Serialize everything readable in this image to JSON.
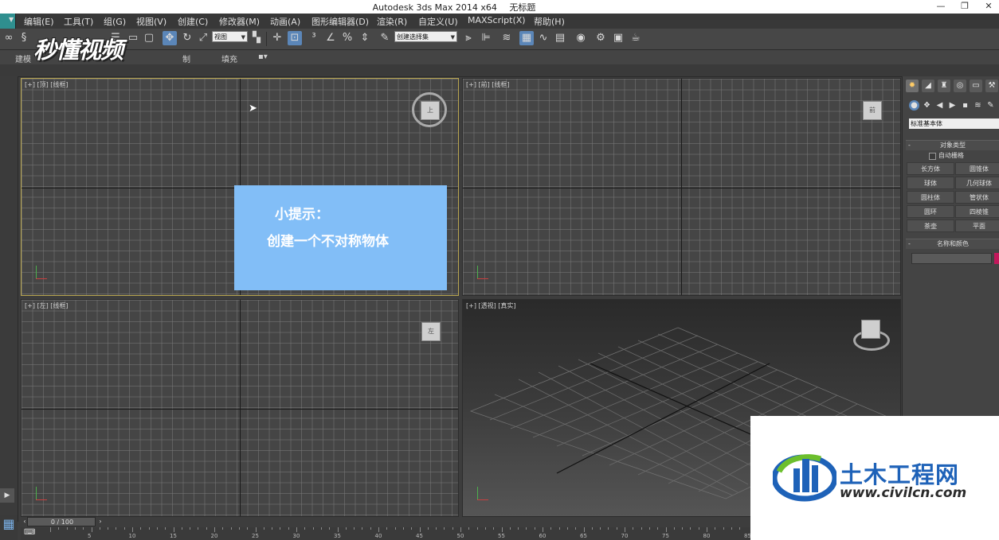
{
  "window": {
    "app_title": "Autodesk 3ds Max  2014 x64",
    "doc_title": "无标题",
    "minimize": "—",
    "restore": "❐",
    "close": "✕"
  },
  "menu": [
    "编辑(E)",
    "工具(T)",
    "组(G)",
    "视图(V)",
    "创建(C)",
    "修改器(M)",
    "动画(A)",
    "图形编辑器(D)",
    "渲染(R)",
    "自定义(U)",
    "MAXScript(X)",
    "帮助(H)"
  ],
  "toolbar": {
    "view_dropdown": "视图",
    "selection_set": "创建选择集"
  },
  "ribbon": {
    "tab_modeling": "建模",
    "tab_freeform": "制",
    "tab_populate": "填充"
  },
  "watermark_brand": "秒懂视频",
  "viewports": {
    "top": "[+] [顶] [线框]",
    "front": "[+] [前] [线框]",
    "left": "[+] [左] [线框]",
    "perspective": "[+] [透视] [真实]",
    "cube_top": "上",
    "cube_front": "前",
    "cube_left": "左"
  },
  "tip": {
    "title": "小提示：",
    "body": "创建一个不对称物体"
  },
  "command_panel": {
    "category": "标准基本体",
    "object_type_header": "对象类型",
    "autogrid": "自动栅格",
    "primitives": [
      "长方体",
      "圆锥体",
      "球体",
      "几何球体",
      "圆柱体",
      "管状体",
      "圆环",
      "四棱锥",
      "茶壶",
      "平面"
    ],
    "name_color_header": "名称和颜色",
    "rollout_toggle": "-",
    "swatch_color": "#c2185b"
  },
  "timeline": {
    "frame": "0 / 100",
    "ticks": [
      "5",
      "10",
      "15",
      "20",
      "25",
      "30",
      "35",
      "40",
      "45",
      "50",
      "55",
      "60",
      "65",
      "70",
      "75",
      "80",
      "85"
    ]
  },
  "civil": {
    "name": "土木工程网",
    "url": "www.civilcn.com"
  }
}
